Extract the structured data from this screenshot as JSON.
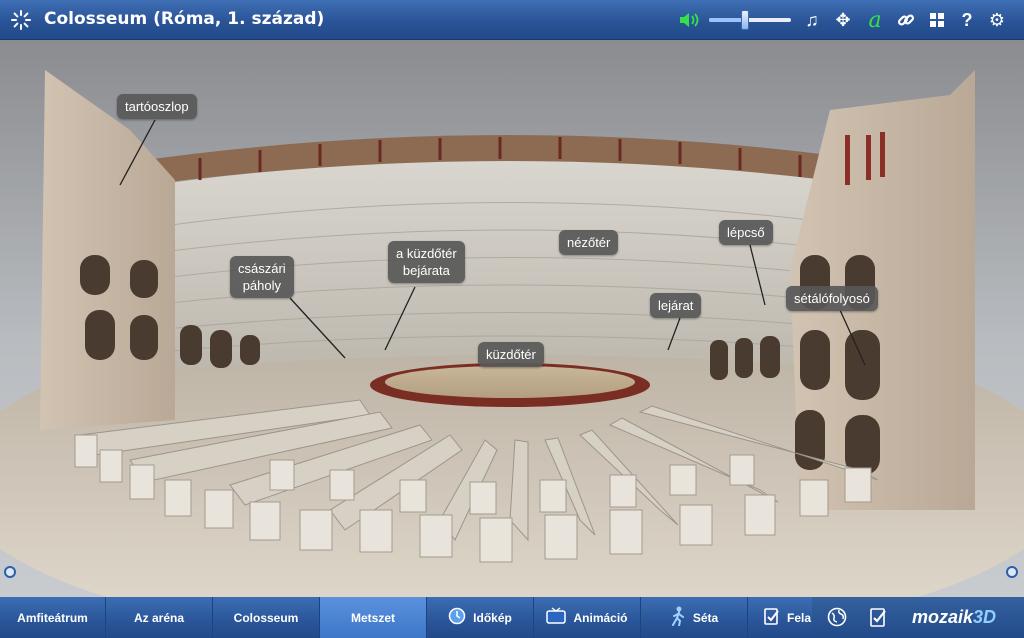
{
  "header": {
    "title": "Colosseum (Róma, 1. század)",
    "volume_level": 0.45,
    "font_icon_glyph": "a"
  },
  "labels": {
    "tartooszlop": "tartóoszlop",
    "csaszari_line1": "császári",
    "csaszari_line2": "páholy",
    "bejarata_line1": "a küzdőtér",
    "bejarata_line2": "bejárata",
    "nezoter": "nézőtér",
    "lepcso": "lépcső",
    "lejarat": "lejárat",
    "setalofolyoso": "sétálófolyosó",
    "kuzdoter": "küzdőtér"
  },
  "tabs": [
    {
      "label": "Amfiteátrum",
      "active": false,
      "icon": ""
    },
    {
      "label": "Az aréna",
      "active": false,
      "icon": ""
    },
    {
      "label": "Colosseum",
      "active": false,
      "icon": ""
    },
    {
      "label": "Metszet",
      "active": true,
      "icon": ""
    },
    {
      "label": "Időkép",
      "active": false,
      "icon": "clock-icon"
    },
    {
      "label": "Animáció",
      "active": false,
      "icon": "tv-icon"
    },
    {
      "label": "Séta",
      "active": false,
      "icon": "walk-icon"
    },
    {
      "label": "Fela",
      "active": false,
      "icon": "task-icon"
    }
  ],
  "brand": {
    "part1": "mozaik",
    "part2": "3D"
  },
  "colors": {
    "accent": "#2a5497",
    "active_tab": "#4a84d2",
    "label_bg": "#585858",
    "volume_green": "#35e04a"
  }
}
